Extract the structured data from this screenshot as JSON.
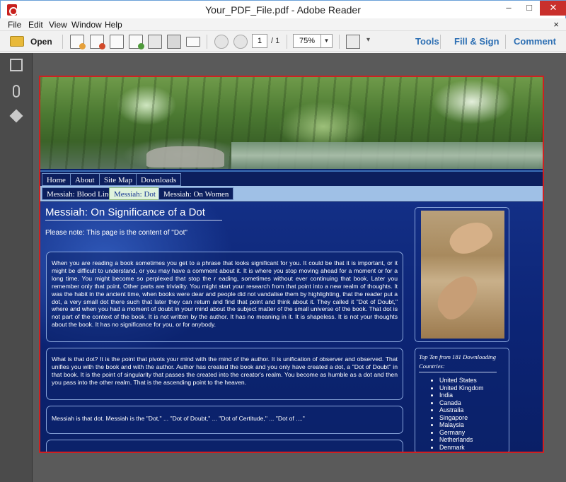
{
  "window": {
    "title": "Your_PDF_File.pdf - Adobe Reader",
    "minimize": "–",
    "maximize": "□",
    "close": "✕"
  },
  "menu": {
    "items": [
      "File",
      "Edit",
      "View",
      "Window",
      "Help"
    ],
    "close_doc": "×"
  },
  "toolbar": {
    "open_label": "Open",
    "page_current": "1",
    "page_total": "/ 1",
    "zoom": "75%",
    "zoom_arrow": "▼",
    "tools_label": "Tools",
    "fill_sign_label": "Fill & Sign",
    "comment_label": "Comment",
    "more_arrow": "▾"
  },
  "document": {
    "nav_primary": [
      "Home",
      "About",
      "Site Map",
      "Downloads"
    ],
    "nav_secondary": [
      "Messiah: Blood Line",
      "Messiah: Dot",
      "Messiah: On Women"
    ],
    "active_secondary": "Messiah: Dot",
    "heading": "Messiah: On Significance of a Dot",
    "note": "Please note: This page is the content of \"Dot\"",
    "paragraph_1": "When you are reading a book sometimes you get to a phrase that looks significant for you. It could be that it is important, or it might be difficult to understand, or you may have a comment about it. It is where you stop moving ahead for a moment or for a long time. You might become so perplexed that stop the r eading, sometimes without ever continuing that book. Later you remember only that point. Other parts are triviality. You might start your research from that point into a new realm of thoughts. It was the habit in the ancient time, when books were dear and people did not vandalise them by highlighting, that the reader put a dot, a very small dot there such that later they can return and find that point and think about it. They called it \"Dot of Doubt,\" where and when you had a moment of doubt in your mind about the subject matter of the small universe of the book. That dot is not part of the context of the book. It is not written by the author. It has no meaning in it. It is shapeless. It is not your thoughts about the book. It has no significance for you, or for anybody.",
    "paragraph_2": "What is that dot? It is the point that pivots your mind with the mind of the author. It is unification of observer and observed. That unifies you with the book and with the author. Author has created the book and you only have created a dot, a \"Dot of Doubt\" in that book. It is the point of singularity that passes the created into the creator's realm. You become as humble as a dot and then you pass into the other realm. That is the ascending point to the heaven.",
    "paragraph_3": "Messiah is that dot. Messiah is the \"Dot,\" ... \"Dot of Doubt,\" ... \"Dot of Certitude,\" ... \"Dot of ....\"",
    "top_ten_title": "Top Ten from 181 Downloading Countries:",
    "countries": [
      "United States",
      "United Kingdom",
      "India",
      "Canada",
      "Australia",
      "Singapore",
      "Malaysia",
      "Germany",
      "Netherlands",
      "Denmark"
    ]
  }
}
